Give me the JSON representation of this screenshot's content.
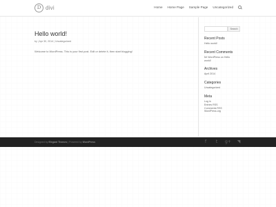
{
  "header": {
    "logo_letter": "D",
    "logo_text": "divi",
    "nav": [
      "Home",
      "Home Page",
      "Sample Page",
      "Uncategorized"
    ],
    "search_icon": "search-icon"
  },
  "post": {
    "title": "Hello world!",
    "meta": {
      "prefix": "by",
      "sep1": "|",
      "date": "Apr 30, 2014",
      "sep2": "|",
      "category": "Uncategorized"
    },
    "body": "Welcome to WordPress. This is your first post. Edit or delete it, then start blogging!"
  },
  "sidebar": {
    "search_placeholder": "",
    "search_button": "Search",
    "recent_posts": {
      "title": "Recent Posts",
      "items": [
        "Hello world!"
      ]
    },
    "recent_comments": {
      "title": "Recent Comments",
      "items": [
        "Mr WordPress on Hello",
        "world!"
      ]
    },
    "archives": {
      "title": "Archives",
      "items": [
        "April 2014"
      ]
    },
    "categories": {
      "title": "Categories",
      "items": [
        "Uncategorized"
      ]
    },
    "meta": {
      "title": "Meta",
      "items": [
        "Log in",
        "Entries RSS",
        "Comments RSS",
        "WordPress.org"
      ]
    }
  },
  "footer": {
    "designed_prefix": "Designed by",
    "designer": "Elegant Themes",
    "powered_prefix": "| Powered by",
    "powered": "WordPress",
    "social_icons": [
      "facebook-icon",
      "twitter-icon",
      "google-plus-icon",
      "rss-icon"
    ],
    "social_glyphs": [
      "f",
      "t",
      "g+",
      "◥"
    ]
  },
  "colors": {
    "footer_bg": "#222222",
    "text": "#666666",
    "heading": "#333333"
  }
}
